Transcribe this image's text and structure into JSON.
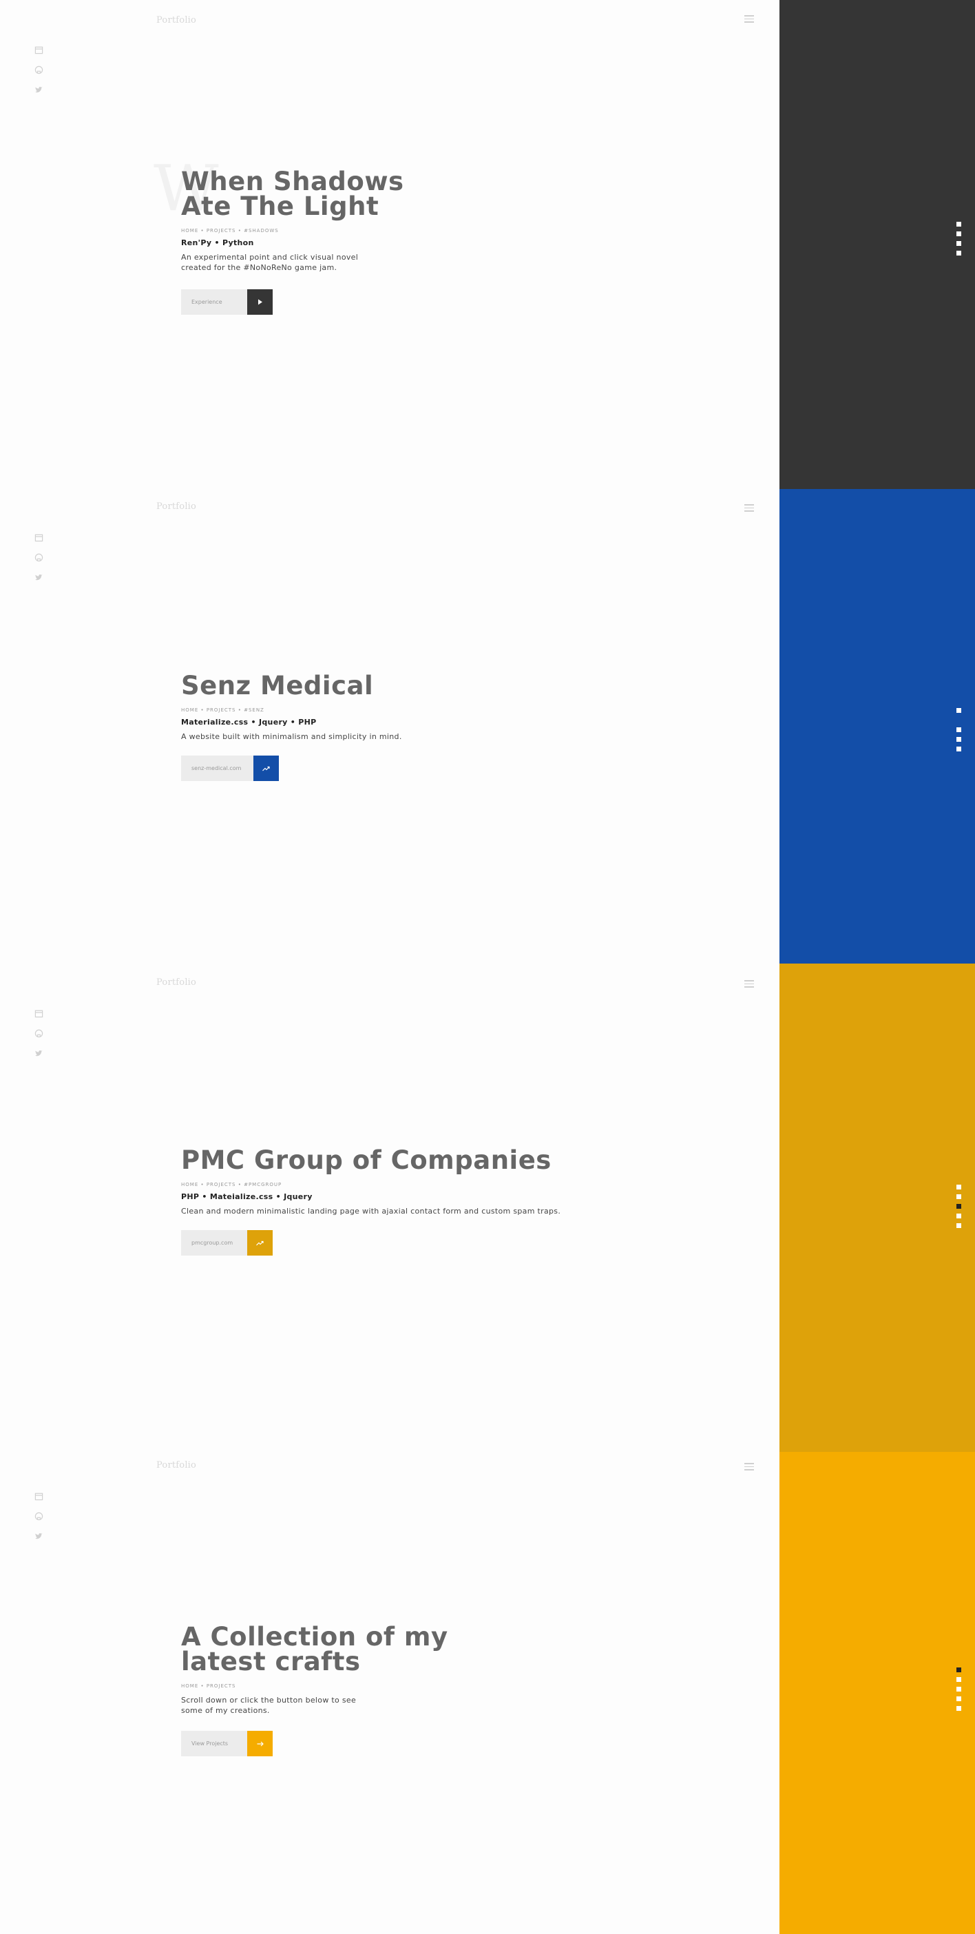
{
  "brand": {
    "logo": "Portfolio"
  },
  "social_icons": [
    "calendar-icon",
    "github-icon",
    "twitter-icon"
  ],
  "colors": {
    "dark": "#353535",
    "blue": "#134ea8",
    "mustard": "#dea20a",
    "yellow": "#f5ac00",
    "title": "#666666"
  },
  "sections": [
    {
      "title_line1": "When Shadows",
      "title_line2": "Ate The Light",
      "watermark": "W",
      "breadcrumb": "HOME • PROJECTS • #SHADOWS",
      "tech": "Ren'Py • Python",
      "desc_line1": "An experimental point and click visual novel",
      "desc_line2": "created for the #NoNoReNo game jam.",
      "button_label": "Experience",
      "button_icon": "play-icon",
      "accent": "#353535",
      "active_dot": 0
    },
    {
      "title_line1": "Senz Medical",
      "breadcrumb": "HOME • PROJECTS • #SENZ",
      "tech": "Materialize.css • Jquery • PHP",
      "desc_line1": "A website built with minimalism and simplicity in mind.",
      "button_label": "senz-medical.com",
      "button_icon": "trending-icon",
      "accent": "#134ea8",
      "active_dot": 1
    },
    {
      "title_line1": "PMC Group of Companies",
      "breadcrumb": "HOME • PROJECTS • #PMCGROUP",
      "tech": "PHP • Mateialize.css • Jquery",
      "desc_line1": "Clean and modern minimalistic landing page with ajaxial contact form and custom spam traps.",
      "button_label": "pmcgroup.com",
      "button_icon": "trending-icon",
      "accent": "#dea20a",
      "active_dot": 2
    },
    {
      "title_line1": "A Collection of my",
      "title_line2": "latest crafts",
      "breadcrumb": "HOME • PROJECTS",
      "desc_line1": "Scroll down or click the button below to see",
      "desc_line2": "some of my creations.",
      "button_label": "View Projects",
      "button_icon": "arrow-right-icon",
      "accent": "#f5ac00",
      "active_dot": 0
    }
  ]
}
